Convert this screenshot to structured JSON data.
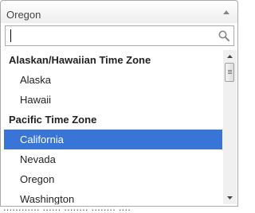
{
  "select": {
    "selected_value": "Oregon"
  },
  "search": {
    "placeholder": "",
    "value": "",
    "icon": "search-icon"
  },
  "groups": [
    {
      "label": "Alaskan/Hawaiian Time Zone",
      "options": [
        "Alaska",
        "Hawaii"
      ]
    },
    {
      "label": "Pacific Time Zone",
      "options": [
        "California",
        "Nevada",
        "Oregon",
        "Washington"
      ]
    }
  ],
  "highlighted_option": "California",
  "colors": {
    "highlight": "#3875d7",
    "border": "#aaaaaa"
  },
  "backdrop_text": "............ ...... ........ ........ ...."
}
